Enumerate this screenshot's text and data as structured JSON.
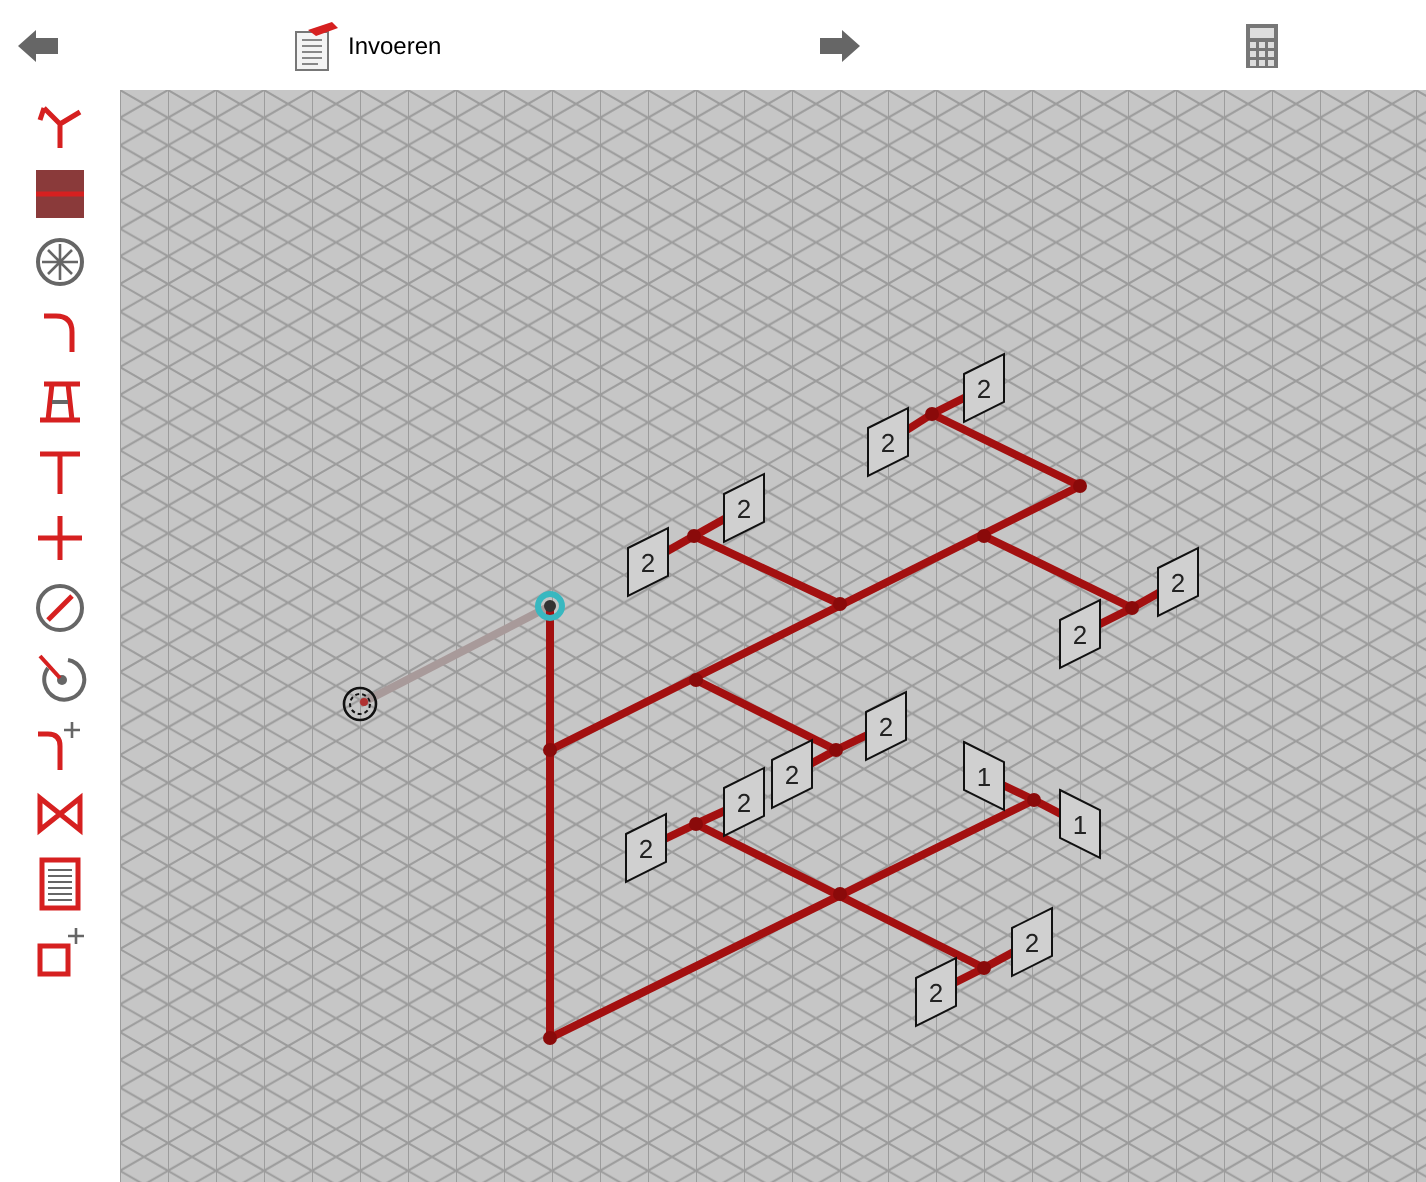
{
  "header": {
    "title": "Invoeren"
  },
  "diagram": {
    "tags": [
      {
        "label": "2",
        "kind": "rise"
      },
      {
        "label": "2",
        "kind": "rise"
      },
      {
        "label": "2",
        "kind": "rise"
      },
      {
        "label": "2",
        "kind": "rise"
      },
      {
        "label": "2",
        "kind": "rise"
      },
      {
        "label": "2",
        "kind": "rise"
      },
      {
        "label": "2",
        "kind": "rise"
      },
      {
        "label": "2",
        "kind": "rise"
      },
      {
        "label": "1",
        "kind": "fall"
      },
      {
        "label": "2",
        "kind": "rise"
      },
      {
        "label": "1",
        "kind": "fall"
      },
      {
        "label": "2",
        "kind": "rise"
      },
      {
        "label": "2",
        "kind": "rise"
      },
      {
        "label": "2",
        "kind": "rise"
      }
    ]
  }
}
